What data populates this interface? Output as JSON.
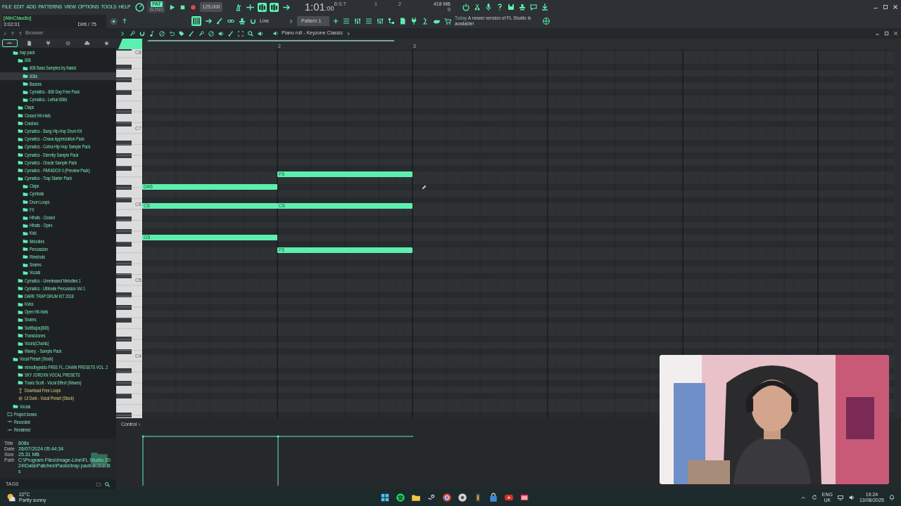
{
  "menu": [
    "FILE",
    "EDIT",
    "ADD",
    "PATTERNS",
    "VIEW",
    "OPTIONS",
    "TOOLS",
    "HELP"
  ],
  "mode": [
    {
      "label": "PAT",
      "selected": true
    },
    {
      "label": "SONG",
      "selected": false
    }
  ],
  "tempo": "125.000",
  "toggles": [
    {
      "on": false
    },
    {
      "on": false
    },
    {
      "on": true
    },
    {
      "on": true
    },
    {
      "on": false
    }
  ],
  "time": {
    "main": "1:01",
    "sub": ":00",
    "unit": "B:S:T"
  },
  "monitor_marks": [
    "1",
    "2"
  ],
  "memory": {
    "usage": "418 MB",
    "polyphony": "0"
  },
  "hint": {
    "user": "[AlinClaudiu]",
    "clock": "3:02:01",
    "note": "D#6 / 75"
  },
  "snap": "Line",
  "pattern": "Pattern 1",
  "news": {
    "when": "Today",
    "text": "A newer version of FL Studio is available!"
  },
  "browser": {
    "title": "Browser",
    "tree": [
      {
        "label": "trap pack",
        "kind": "folder",
        "selected": false,
        "children": [
          {
            "label": "808",
            "kind": "folder",
            "selected": false,
            "children": [
              {
                "label": "808 Bass Samples by Ihaksi",
                "kind": "folder",
                "selected": false
              },
              {
                "label": "808s",
                "kind": "folder",
                "selected": true
              },
              {
                "label": "Basses",
                "kind": "folder",
                "selected": false
              },
              {
                "label": "Cymatics - 808 Day Free Pack",
                "kind": "folder",
                "selected": false
              },
              {
                "label": "Cymatics - Lethal 808s",
                "kind": "folder",
                "selected": false
              }
            ]
          },
          {
            "label": "Claps",
            "kind": "folder",
            "selected": false
          },
          {
            "label": "Closed Hit-Hats",
            "kind": "folder",
            "selected": false
          },
          {
            "label": "Crashes",
            "kind": "folder",
            "selected": false
          },
          {
            "label": "Cymatics - Bang Hip-Hop Drum Kit",
            "kind": "folder",
            "selected": false
          },
          {
            "label": "Cymatics - Chaos Appreciation Pack",
            "kind": "folder",
            "selected": false
          },
          {
            "label": "Cymatics - Cobra Hip Hop Sample Pack",
            "kind": "folder",
            "selected": false
          },
          {
            "label": "Cymatics - Eternity Sample Pack",
            "kind": "folder",
            "selected": false
          },
          {
            "label": "Cymatics - Oracle Sample Pack",
            "kind": "folder",
            "selected": false
          },
          {
            "label": "Cymatics - PARADOX II (Preview Pack)",
            "kind": "folder",
            "selected": false
          },
          {
            "label": "Cymatics - Trap Starter Pack",
            "kind": "folder",
            "selected": false,
            "children": [
              {
                "label": "Claps",
                "kind": "folder",
                "selected": false
              },
              {
                "label": "Cymbals",
                "kind": "folder",
                "selected": false
              },
              {
                "label": "Drum Loops",
                "kind": "folder",
                "selected": false
              },
              {
                "label": "FX",
                "kind": "folder",
                "selected": false
              },
              {
                "label": "Hihats - Closed",
                "kind": "folder",
                "selected": false
              },
              {
                "label": "Hihats - Open",
                "kind": "folder",
                "selected": false
              },
              {
                "label": "Kick",
                "kind": "folder",
                "selected": false
              },
              {
                "label": "Melodies",
                "kind": "folder",
                "selected": false
              },
              {
                "label": "Percussion",
                "kind": "folder",
                "selected": false
              },
              {
                "label": "Rimshots",
                "kind": "folder",
                "selected": false
              },
              {
                "label": "Snares",
                "kind": "folder",
                "selected": false
              },
              {
                "label": "Vocals",
                "kind": "folder",
                "selected": false
              }
            ]
          },
          {
            "label": "Cymatics - Unreleased Melodies 1",
            "kind": "folder",
            "selected": false
          },
          {
            "label": "Cymatics - Ultimate Percussion Vol 1",
            "kind": "folder",
            "selected": false
          },
          {
            "label": "DARK TRAP DRUM KIT 2018",
            "kind": "folder",
            "selected": false
          },
          {
            "label": "Kicks",
            "kind": "folder",
            "selected": false
          },
          {
            "label": "Open Hit-Hats",
            "kind": "folder",
            "selected": false
          },
          {
            "label": "Snares",
            "kind": "folder",
            "selected": false
          },
          {
            "label": "SubBajos(808)",
            "kind": "folder",
            "selected": false
          },
          {
            "label": "Transiciones",
            "kind": "folder",
            "selected": false
          },
          {
            "label": "Voces(Chants)",
            "kind": "folder",
            "selected": false
          },
          {
            "label": "Wavey. - Sample Pack",
            "kind": "folder",
            "selected": false
          }
        ]
      },
      {
        "label": "Vocal Preset (Stock)",
        "kind": "folder",
        "selected": false,
        "children": [
          {
            "label": "mixedbyyeldo FREE FL..CHAIN PRESETS VOL. 2",
            "kind": "folder",
            "selected": false
          },
          {
            "label": "SKY JORDXN VOCAL PRESETS",
            "kind": "folder",
            "selected": false
          },
          {
            "label": "Travis Scott - Vocal Effect (Waves)",
            "kind": "folder",
            "selected": false
          },
          {
            "label": "Download Free Loops",
            "kind": "link",
            "selected": false
          },
          {
            "label": "Lil Durk - Vocal Preset (Stock)",
            "kind": "preset",
            "selected": false
          }
        ]
      },
      {
        "label": "Vocals",
        "kind": "folder",
        "selected": false
      }
    ],
    "places": [
      {
        "label": "Project bones",
        "kind": "project"
      },
      {
        "label": "Recorded",
        "kind": "audio"
      },
      {
        "label": "Rendered",
        "kind": "audio"
      }
    ],
    "info": [
      {
        "key": "Title",
        "value": "808s"
      },
      {
        "key": "Date",
        "value": "26/07/2024 05:44:34"
      },
      {
        "key": "Size",
        "value": "25.31 MB"
      },
      {
        "key": "Path",
        "value": "C:\\Program Files\\Image-Line\\FL Studio 2024\\Data\\Patches\\Packs\\trap pack\\808\\808s"
      }
    ],
    "tags_label": "TAGS"
  },
  "piano_roll": {
    "title": "Piano roll - Keyzone Classic",
    "bar_numbers": [
      "2",
      "3"
    ],
    "octaves": [
      "C8",
      "C7",
      "C6",
      "C5",
      "C4"
    ],
    "notes": [
      {
        "label": "F6"
      },
      {
        "label": "D#6"
      },
      {
        "label": "C6"
      },
      {
        "label": "C6"
      },
      {
        "label": "G5"
      },
      {
        "label": "F5"
      }
    ],
    "control_label": "Control"
  },
  "taskbar": {
    "temp": "22°C",
    "weather": "Partly sunny",
    "lang": "ENG",
    "region": "UK",
    "time": "19:24",
    "date": "13/08/2025"
  }
}
